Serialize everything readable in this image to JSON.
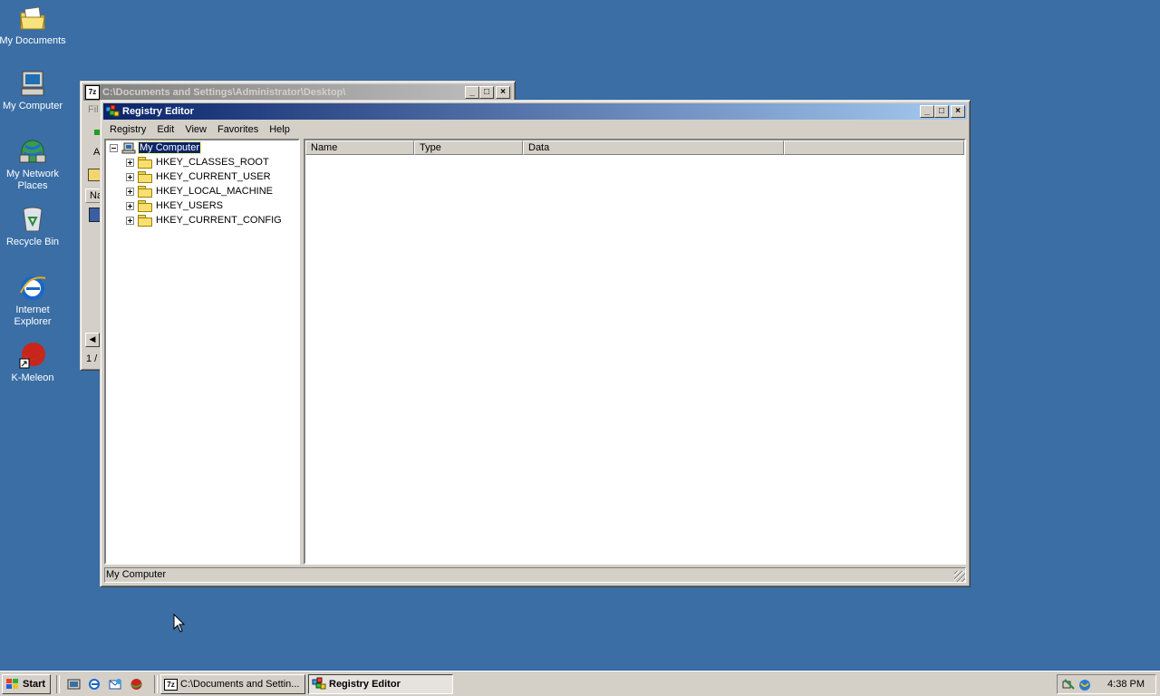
{
  "desktop": {
    "icons": [
      {
        "label": "My Documents"
      },
      {
        "label": "My Computer"
      },
      {
        "label": "My Network Places"
      },
      {
        "label": "Recycle Bin"
      },
      {
        "label": "Internet Explorer"
      },
      {
        "label": "K-Meleon"
      }
    ]
  },
  "bg_window": {
    "title": "C:\\Documents and Settings\\Administrator\\Desktop\\",
    "icon_text": "7z",
    "menu_fragment": "Fil",
    "addr_fragment": "A",
    "col_fragment": "Na",
    "status_fragment": "1 /"
  },
  "regedit": {
    "title": "Registry Editor",
    "menu": [
      "Registry",
      "Edit",
      "View",
      "Favorites",
      "Help"
    ],
    "tree_root": "My Computer",
    "tree_items": [
      "HKEY_CLASSES_ROOT",
      "HKEY_CURRENT_USER",
      "HKEY_LOCAL_MACHINE",
      "HKEY_USERS",
      "HKEY_CURRENT_CONFIG"
    ],
    "columns": [
      "Name",
      "Type",
      "Data"
    ],
    "status": "My Computer"
  },
  "taskbar": {
    "start_label": "Start",
    "tasks": [
      {
        "label": "C:\\Documents and Settin...",
        "icon_text": "7z"
      },
      {
        "label": "Registry Editor"
      }
    ],
    "clock": "4:38 PM"
  },
  "colors": {
    "desktop": "#3a6ea5",
    "title_active": "#0a246a",
    "title_inactive": "#808080",
    "face": "#d4d0c8"
  }
}
